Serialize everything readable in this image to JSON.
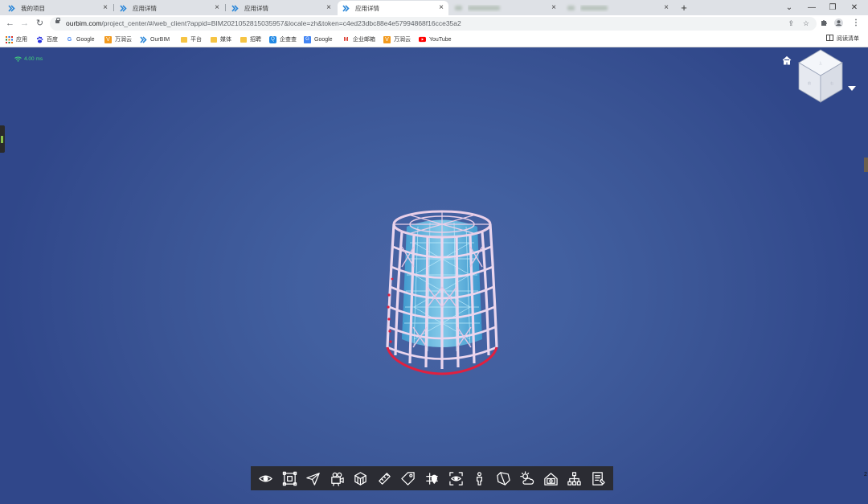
{
  "tabs": [
    {
      "title": "我的项目",
      "close": "×"
    },
    {
      "title": "应用详情",
      "close": "×"
    },
    {
      "title": "应用详情",
      "close": "×"
    },
    {
      "title": "应用详情",
      "close": "×"
    },
    {
      "title": "",
      "close": "×"
    },
    {
      "title": "",
      "close": "×"
    }
  ],
  "new_tab": "+",
  "window": {
    "collapse": "⌄",
    "minimize": "—",
    "restore": "❐",
    "close": "✕"
  },
  "nav": {
    "back": "←",
    "forward": "→",
    "reload": "↻"
  },
  "address": {
    "host": "ourbim.com",
    "path": "/project_center/#/web_client?appid=BIM2021052815035957&locale=zh&token=c4ed23dbc88e4e57994868f16cce35a2"
  },
  "omnibox_icons": [
    "share-icon",
    "star-icon"
  ],
  "toolbar_icons": [
    "extension-icon",
    "profile-icon",
    "kebab-menu-icon"
  ],
  "bookmarks": [
    {
      "label": "应用",
      "icon": "apps-grid-icon"
    },
    {
      "label": "百度",
      "icon": "baidu-icon"
    },
    {
      "label": "Google",
      "icon": "google-icon"
    },
    {
      "label": "万润云",
      "icon": "wanrun-icon"
    },
    {
      "label": "OurBIM",
      "icon": "ourbim-icon"
    },
    {
      "label": "平台",
      "icon": "folder-icon"
    },
    {
      "label": "媒体",
      "icon": "folder-icon"
    },
    {
      "label": "招聘",
      "icon": "folder-icon"
    },
    {
      "label": "企查查",
      "icon": "qichacha-icon"
    },
    {
      "label": "Google",
      "icon": "google-translate-icon"
    },
    {
      "label": "企业邮箱",
      "icon": "gmail-icon"
    },
    {
      "label": "万润云",
      "icon": "wanrun-icon"
    },
    {
      "label": "YouTube",
      "icon": "youtube-icon"
    }
  ],
  "reading_list": "阅读清单",
  "viewer": {
    "latency": "4.00 ms",
    "latency_color": "#41d67a",
    "background": "#3c5491"
  },
  "tools": [
    {
      "name": "view-icon"
    },
    {
      "name": "select-box-icon"
    },
    {
      "name": "roam-icon"
    },
    {
      "name": "camera-icon"
    },
    {
      "name": "model-box-icon"
    },
    {
      "name": "measure-icon"
    },
    {
      "name": "tag-icon"
    },
    {
      "name": "locate-icon"
    },
    {
      "name": "focus-view-icon"
    },
    {
      "name": "person-icon"
    },
    {
      "name": "section-icon"
    },
    {
      "name": "weather-icon"
    },
    {
      "name": "screenshot-icon"
    },
    {
      "name": "tree-icon"
    },
    {
      "name": "properties-icon"
    }
  ],
  "page_number": "2"
}
